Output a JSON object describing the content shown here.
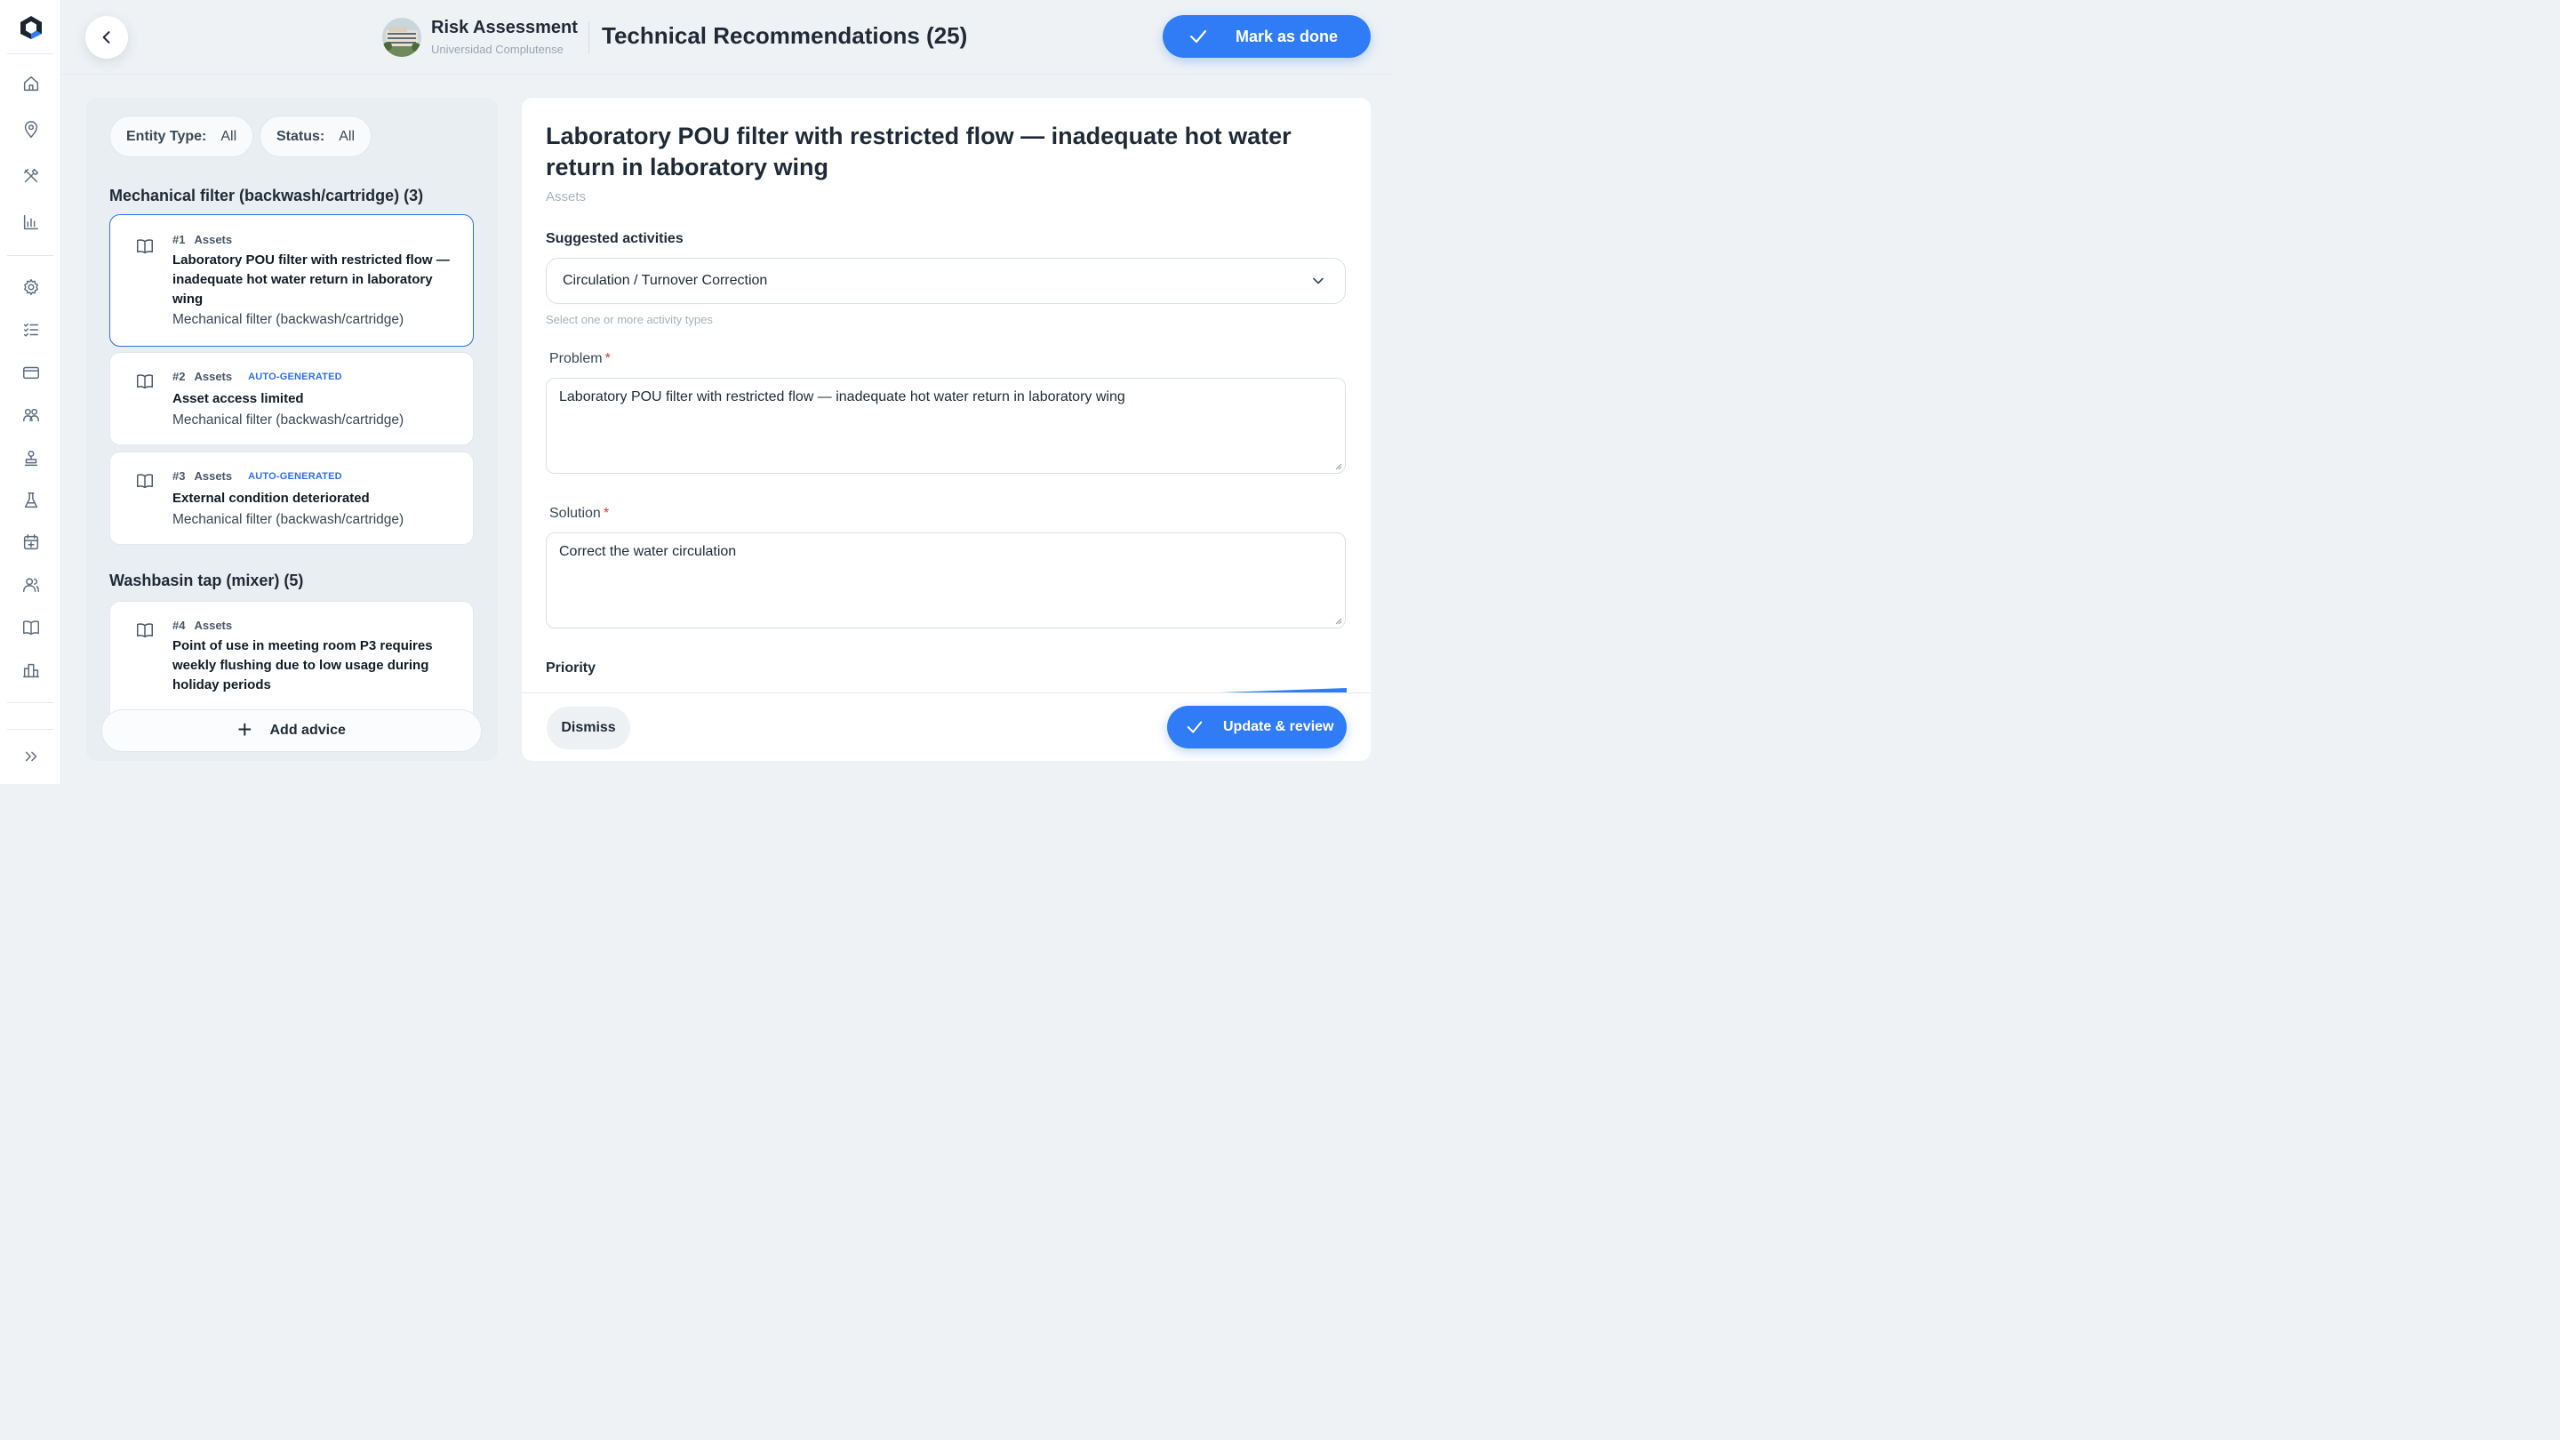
{
  "header": {
    "app_title": "Risk Assessment",
    "app_subtitle": "Universidad Complutense",
    "page_title": "Technical Recommendations (25)",
    "mark_done_label": "Mark as done"
  },
  "filters": {
    "entity_type": {
      "label": "Entity Type:",
      "value": "All"
    },
    "status": {
      "label": "Status:",
      "value": "All"
    }
  },
  "groups": [
    {
      "title": "Mechanical filter (backwash/cartridge) (3)",
      "items": [
        {
          "num": "#1",
          "category": "Assets",
          "badge": "",
          "title": "Laboratory POU filter with restricted flow — inadequate hot water return in laboratory wing",
          "subtitle": "Mechanical filter (backwash/cartridge)"
        },
        {
          "num": "#2",
          "category": "Assets",
          "badge": "AUTO-GENERATED",
          "title": "Asset access limited",
          "subtitle": "Mechanical filter (backwash/cartridge)"
        },
        {
          "num": "#3",
          "category": "Assets",
          "badge": "AUTO-GENERATED",
          "title": "External condition deteriorated",
          "subtitle": "Mechanical filter (backwash/cartridge)"
        }
      ]
    },
    {
      "title": "Washbasin tap (mixer) (5)",
      "items": [
        {
          "num": "#4",
          "category": "Assets",
          "badge": "",
          "title": "Point of use in meeting room P3 requires weekly flushing due to low usage during holiday periods",
          "subtitle": ""
        }
      ]
    }
  ],
  "add_advice_label": "Add advice",
  "detail": {
    "title": "Laboratory POU filter with restricted flow — inadequate hot water return in laboratory wing",
    "category": "Assets",
    "suggested_label": "Suggested activities",
    "suggested_value": "Circulation / Turnover Correction",
    "suggested_hint": "Select one or more activity types",
    "problem_label": "Problem",
    "problem_value": "Laboratory POU filter with restricted flow — inadequate hot water return in laboratory wing",
    "solution_label": "Solution",
    "solution_value": "Correct the water circulation",
    "required_mark": "*",
    "priority_label": "Priority",
    "dismiss_label": "Dismiss",
    "update_label": "Update & review"
  },
  "icons": {
    "sidebar": [
      "home-icon",
      "location-pin-icon",
      "tools-icon",
      "bar-chart-icon",
      "gear-icon",
      "checklist-icon",
      "card-icon",
      "groups-icon",
      "stamp-icon",
      "flask-icon",
      "calendar-icon",
      "users-icon",
      "book-icon",
      "building-chart-icon",
      "expand-icon"
    ]
  },
  "colors": {
    "accent": "#2f7cf6",
    "selected_border": "#2f6fe6",
    "badge": "#2f6fe6",
    "required": "#e0342f"
  }
}
